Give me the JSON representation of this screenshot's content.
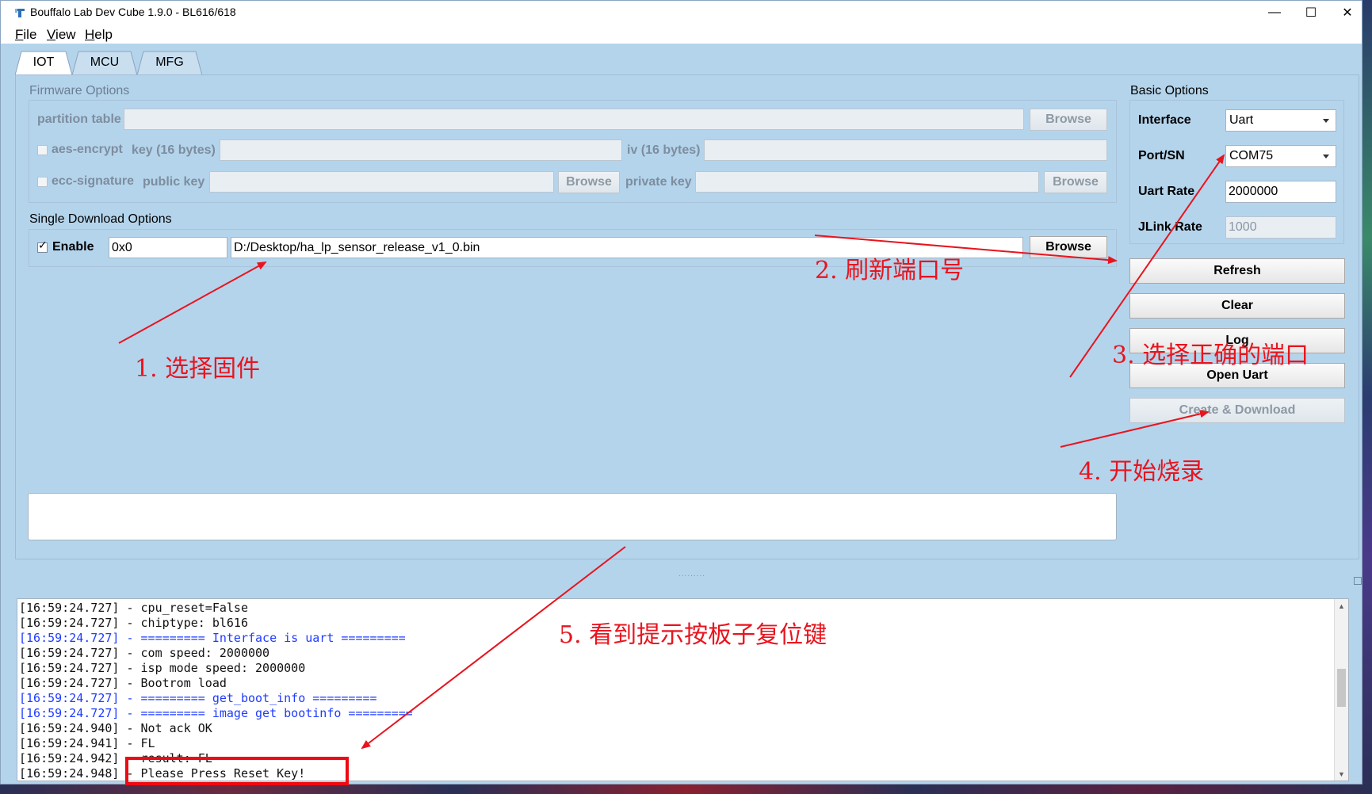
{
  "window": {
    "title": "Bouffalo Lab Dev Cube 1.9.0 - BL616/618",
    "controls": {
      "minimize": "—",
      "maximize": "☐",
      "close": "✕"
    }
  },
  "menu": [
    {
      "key": "F",
      "rest": "ile"
    },
    {
      "key": "V",
      "rest": "iew"
    },
    {
      "key": "H",
      "rest": "elp"
    }
  ],
  "tabs": [
    {
      "label": "IOT",
      "active": true
    },
    {
      "label": "MCU",
      "active": false
    },
    {
      "label": "MFG",
      "active": false
    }
  ],
  "firmware_options": {
    "title": "Firmware Options",
    "partition_table": {
      "label": "partition table",
      "value": "",
      "browse": "Browse"
    },
    "aes_encrypt": {
      "label": "aes-encrypt",
      "checked": false,
      "key_label": "key (16 bytes)",
      "key_value": "",
      "iv_label": "iv (16 bytes)",
      "iv_value": ""
    },
    "ecc_signature": {
      "label": "ecc-signature",
      "checked": false,
      "public_key_label": "public key",
      "public_key_value": "",
      "browse1": "Browse",
      "private_key_label": "private key",
      "private_key_value": "",
      "browse2": "Browse"
    }
  },
  "single_download": {
    "title": "Single Download Options",
    "enable_label": "Enable",
    "enabled": true,
    "check_mark": "✓",
    "address": "0x0",
    "file_path": "D:/Desktop/ha_lp_sensor_release_v1_0.bin",
    "browse": "Browse"
  },
  "basic_options": {
    "title": "Basic Options",
    "interface": {
      "label": "Interface",
      "value": "Uart"
    },
    "port": {
      "label": "Port/SN",
      "value": "COM75"
    },
    "uart_rate": {
      "label": "Uart Rate",
      "value": "2000000"
    },
    "jlink_rate": {
      "label": "JLink Rate",
      "value": "1000"
    }
  },
  "buttons": {
    "refresh": "Refresh",
    "clear": "Clear",
    "log": "Log",
    "open_uart": "Open Uart",
    "create_download": "Create & Download"
  },
  "log_lines": [
    {
      "text": "[16:59:24.727] - cpu_reset=False",
      "color": "black"
    },
    {
      "text": "[16:59:24.727] - chiptype: bl616",
      "color": "black"
    },
    {
      "text": "[16:59:24.727] - ========= Interface is uart =========",
      "color": "blue"
    },
    {
      "text": "[16:59:24.727] - com speed: 2000000",
      "color": "black"
    },
    {
      "text": "[16:59:24.727] - isp mode speed: 2000000",
      "color": "black"
    },
    {
      "text": "[16:59:24.727] - Bootrom load",
      "color": "black"
    },
    {
      "text": "[16:59:24.727] - ========= get_boot_info =========",
      "color": "blue"
    },
    {
      "text": "[16:59:24.727] - ========= image get bootinfo =========",
      "color": "blue"
    },
    {
      "text": "[16:59:24.940] - Not ack OK",
      "color": "black"
    },
    {
      "text": "[16:59:24.941] - FL",
      "color": "black"
    },
    {
      "text": "[16:59:24.942] - result: FL",
      "color": "black"
    },
    {
      "text": "[16:59:24.948] - Please Press Reset Key!",
      "color": "black"
    }
  ],
  "annotations": {
    "step1": "1. 选择固件",
    "step2": "2. 刷新端口号",
    "step3": "3. 选择正确的端口",
    "step4": "4. 开始烧录",
    "step5": "5. 看到提示按板子复位键",
    "color": "#e8141e"
  }
}
